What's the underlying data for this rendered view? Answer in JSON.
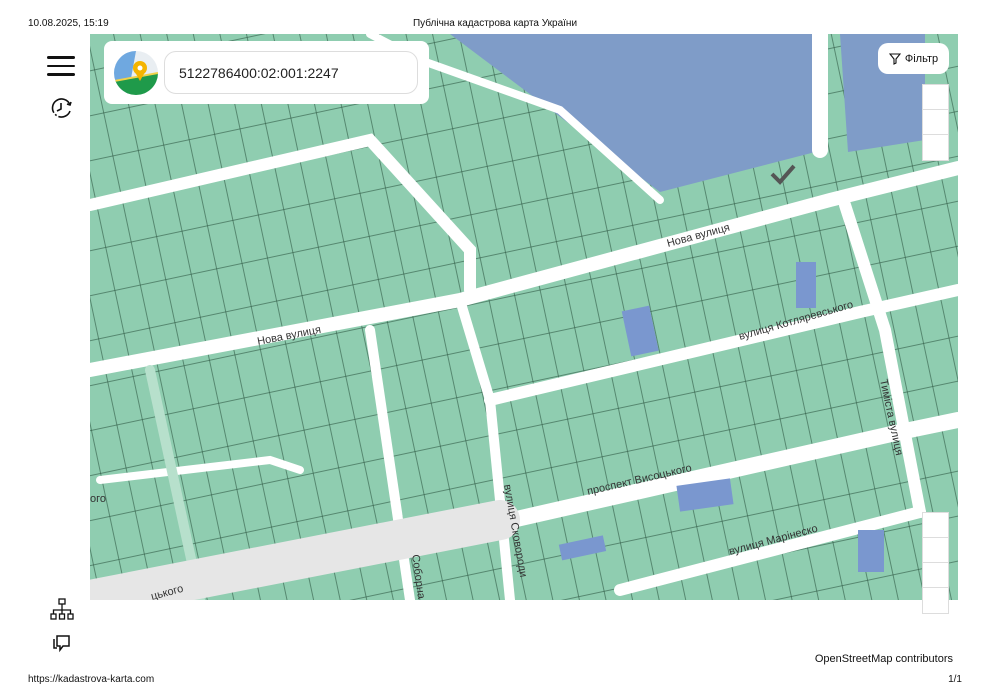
{
  "header": {
    "datetime": "10.08.2025, 15:19",
    "title": "Публічна кадастрова карта України"
  },
  "search": {
    "value": "5122786400:02:001:2247"
  },
  "filter": {
    "label": "Фільтр",
    "icon": "filter-icon"
  },
  "map": {
    "streets": [
      "Нова вулиця",
      "Нова вулиця",
      "вулиця Котляревського",
      "проспект Висоцького",
      "вулиця Марінеско",
      "вулиця Сковороди",
      "Соборна в",
      "Тиміста вулиця",
      "цького",
      "ого"
    ],
    "colors": {
      "parcel": "#8fcdb0",
      "water": "#7f9cc8",
      "road": "#ffffff",
      "selected": "#7a97cf"
    }
  },
  "attribution": "OpenStreetMap contributors",
  "footer": {
    "url": "https://kadastrova-karta.com",
    "page": "1/1"
  }
}
